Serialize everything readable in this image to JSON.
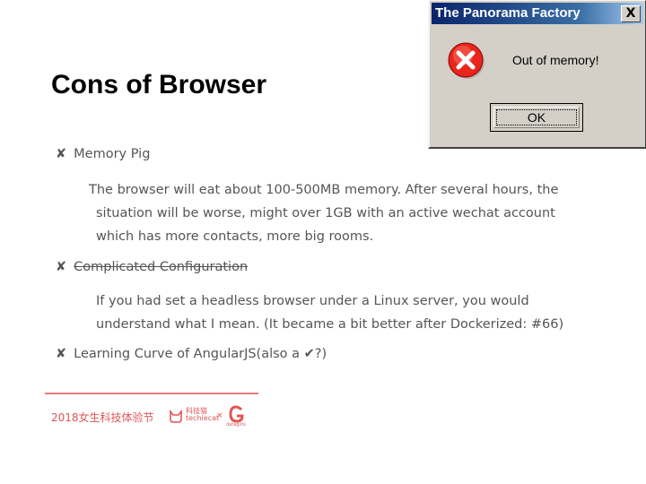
{
  "slide": {
    "title": "Cons of Browser",
    "bullets": [
      {
        "mark": "✘",
        "label": "Memory Pig"
      },
      {
        "mark": "✘",
        "label": "Complicated Configuration"
      },
      {
        "mark": "✘",
        "label": "Learning Curve of AngularJS(also a ✔?)"
      }
    ],
    "memory_text": [
      "The browser will eat about 100-500MB memory. After several hours, the",
      "situation will be worse, might over 1GB with an active wechat account",
      "which has more contacts, more big rooms."
    ],
    "config_text": [
      "If you had set a headless browser under a Linux server, you would",
      "understand what I mean. (It became a bit better after Dockerized: #66)"
    ]
  },
  "dialog": {
    "title": "The Panorama Factory",
    "close": "X",
    "message": "Out of memory!",
    "ok": "OK",
    "icon": "error-icon"
  },
  "footer": {
    "event": "2018女生科技体验节",
    "sponsor1": "techiecat",
    "sponsor1_cn": "科技猫",
    "separator": "×",
    "sponsor2": "datagirls",
    "accent": "#e05656"
  }
}
